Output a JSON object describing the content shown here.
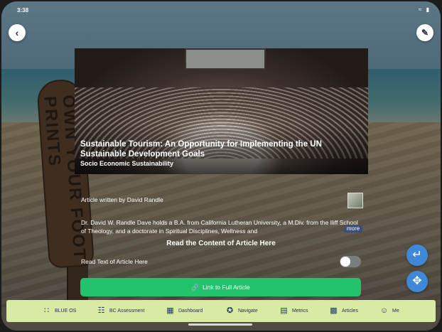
{
  "status_bar": {
    "time": "3:38",
    "icons": "wifi battery"
  },
  "header": {
    "back_icon": "chevron-left-icon",
    "edit_icon": "pencil-icon"
  },
  "article": {
    "title": "Sustainable Tourism: An Opportunity for Implementing the UN Sustainable Development Goals",
    "category": "Socio Economic Sustainability",
    "author_line": "Article written by David Randle",
    "bio": "Dr. David W. Randle Dave holds a B.A. from California Lutheran University, a M.Div. from the Iliff School of Theology, and a doctorate in Spiritual Disciplines, Wellness and",
    "more_label": "more",
    "read_heading": "Read the Content of Article Here",
    "read_text_label": "Read Text of Article Here",
    "read_text_toggle_on": false,
    "link_label": "Link to Full Article"
  },
  "fabs": {
    "return_icon": "return-arrow-icon",
    "move_icon": "move-arrows-icon"
  },
  "tabbar": {
    "items": [
      {
        "label": "BLUE OS",
        "icon": "grid-dots-icon"
      },
      {
        "label": "BC Assessment",
        "icon": "hierarchy-icon"
      },
      {
        "label": "Dashboard",
        "icon": "dashboard-icon"
      },
      {
        "label": "Navigate",
        "icon": "compass-icon"
      },
      {
        "label": "Metrics",
        "icon": "chart-icon"
      },
      {
        "label": "Articles",
        "icon": "articles-icon"
      },
      {
        "label": "Me",
        "icon": "person-icon"
      }
    ]
  },
  "colors": {
    "accent_green": "#22c36a",
    "tabbar_bg": "#d9eaa5",
    "fab_blue": "#3f88d8"
  }
}
